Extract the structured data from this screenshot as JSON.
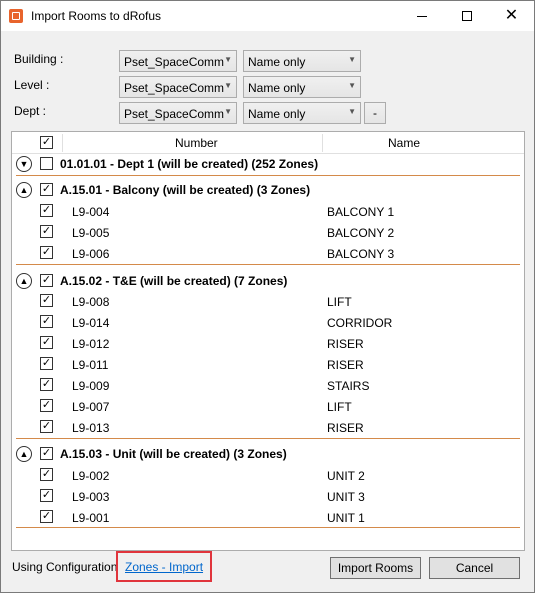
{
  "window": {
    "title": "Import Rooms to dRofus"
  },
  "filters": {
    "building": {
      "label": "Building :",
      "property": "Pset_SpaceComm",
      "mode": "Name only"
    },
    "level": {
      "label": "Level :",
      "property": "Pset_SpaceComm",
      "mode": "Name only"
    },
    "dept": {
      "label": "Dept :",
      "property": "Pset_SpaceComm",
      "mode": "Name only"
    },
    "remove_label": "-"
  },
  "table": {
    "columns": {
      "number": "Number",
      "name": "Name"
    },
    "groups": [
      {
        "title": "01.01.01 - Dept 1 (will be created) (252 Zones)",
        "expanded": false,
        "checked": false,
        "rows": []
      },
      {
        "title": "A.15.01 - Balcony (will be created) (3 Zones)",
        "expanded": true,
        "checked": true,
        "rows": [
          {
            "number": "L9-004",
            "name": "BALCONY 1"
          },
          {
            "number": "L9-005",
            "name": "BALCONY 2"
          },
          {
            "number": "L9-006",
            "name": "BALCONY 3"
          }
        ]
      },
      {
        "title": "A.15.02 - T&E (will be created) (7 Zones)",
        "expanded": true,
        "checked": true,
        "rows": [
          {
            "number": "L9-008",
            "name": "LIFT"
          },
          {
            "number": "L9-014",
            "name": "CORRIDOR"
          },
          {
            "number": "L9-012",
            "name": "RISER"
          },
          {
            "number": "L9-011",
            "name": "RISER"
          },
          {
            "number": "L9-009",
            "name": "STAIRS"
          },
          {
            "number": "L9-007",
            "name": "LIFT"
          },
          {
            "number": "L9-013",
            "name": "RISER"
          }
        ]
      },
      {
        "title": "A.15.03 - Unit (will be created) (3 Zones)",
        "expanded": true,
        "checked": true,
        "rows": [
          {
            "number": "L9-002",
            "name": "UNIT 2"
          },
          {
            "number": "L9-003",
            "name": "UNIT 3"
          },
          {
            "number": "L9-001",
            "name": "UNIT 1"
          }
        ]
      }
    ]
  },
  "footer": {
    "config_label": "Using Configuration",
    "config_link": "Zones - Import",
    "import_button": "Import Rooms",
    "cancel_button": "Cancel"
  }
}
